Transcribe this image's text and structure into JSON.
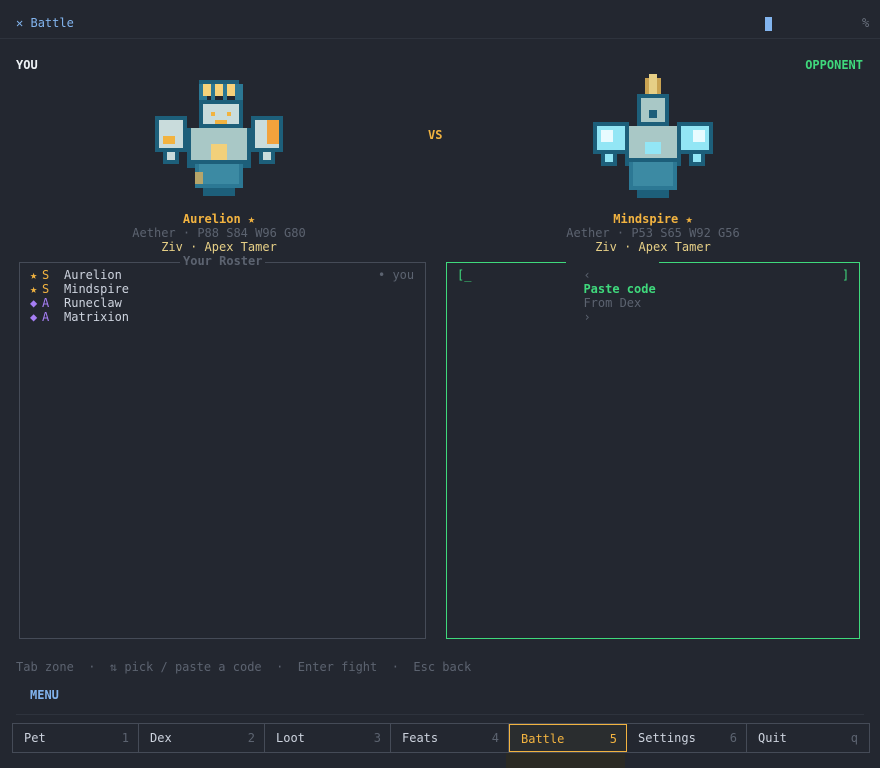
{
  "window": {
    "title": "Battle",
    "close_glyph": "%"
  },
  "you_label": "YOU",
  "opponent_label": "OPPONENT",
  "vs_label": "VS",
  "player": {
    "pet_name": "Aurelion ★",
    "stats": "Aether · P88 S84 W96 G80",
    "tamer": "Ziv · Apex Tamer"
  },
  "opponent": {
    "pet_name": "Mindspire ★",
    "stats": "Aether · P53 S65 W92 G56",
    "tamer": "Ziv · Apex Tamer"
  },
  "roster": {
    "title": "Your Roster",
    "owner_tag": "• you",
    "items": [
      {
        "marker": "★",
        "tier": "S",
        "name": "Aurelion",
        "color": "#f2b340"
      },
      {
        "marker": "★",
        "tier": "S",
        "name": "Mindspire",
        "color": "#f2b340"
      },
      {
        "marker": "◆",
        "tier": "A",
        "name": "Runeclaw",
        "color": "#a67ef5"
      },
      {
        "marker": "◆",
        "tier": "A",
        "name": "Matrixion",
        "color": "#a67ef5"
      }
    ]
  },
  "code_panel": {
    "prev_arrow": "‹",
    "active_tab": "Paste code",
    "other_tab": "From Dex",
    "next_arrow": "›",
    "input_open": "[_",
    "input_close": "]"
  },
  "hints": {
    "tab": "Tab zone",
    "pick": "⇅ pick / paste a code",
    "enter": "Enter fight",
    "esc": "Esc back"
  },
  "menu": {
    "label": "MENU",
    "tabs": [
      {
        "label": "Pet",
        "key": "1"
      },
      {
        "label": "Dex",
        "key": "2"
      },
      {
        "label": "Loot",
        "key": "3"
      },
      {
        "label": "Feats",
        "key": "4"
      },
      {
        "label": "Battle",
        "key": "5"
      },
      {
        "label": "Settings",
        "key": "6"
      },
      {
        "label": "Quit",
        "key": "q"
      }
    ],
    "active_index": 4
  },
  "colors": {
    "accent": "#f2b340",
    "opponent": "#3fd97c",
    "title": "#82b4ee",
    "tier_a": "#a67ef5"
  }
}
